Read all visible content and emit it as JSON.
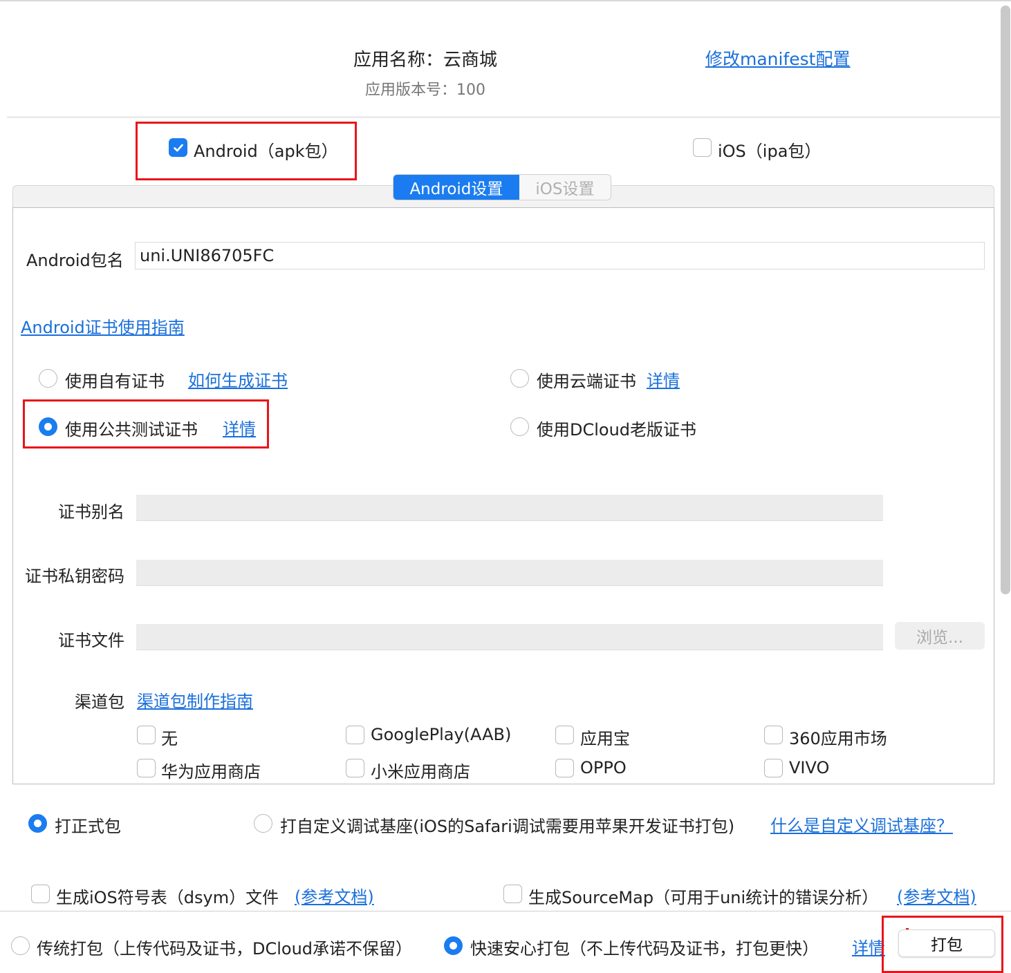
{
  "header": {
    "app_name": "应用名称：云商城",
    "app_version": "应用版本号：100",
    "manifest_link": "修改manifest配置"
  },
  "platforms": {
    "android": {
      "label": "Android（apk包）",
      "checked": true
    },
    "ios": {
      "label": "iOS（ipa包）",
      "checked": false
    }
  },
  "tabs": [
    {
      "label": "Android设置",
      "active": true
    },
    {
      "label": "iOS设置",
      "active": false
    }
  ],
  "android": {
    "package_label": "Android包名",
    "package_value": "uni.UNI86705FC",
    "cert_guide_link": "Android证书使用指南",
    "cert_options": {
      "own": {
        "label": "使用自有证书",
        "link": "如何生成证书",
        "checked": false
      },
      "cloud": {
        "label": "使用云端证书",
        "link": "详情",
        "checked": false
      },
      "public": {
        "label": "使用公共测试证书",
        "link": "详情",
        "checked": true
      },
      "dcloud_old": {
        "label": "使用DCloud老版证书",
        "checked": false
      }
    },
    "cert_alias_label": "证书别名",
    "cert_alias_value": "",
    "cert_password_label": "证书私钥密码",
    "cert_password_value": "",
    "cert_file_label": "证书文件",
    "cert_file_value": "",
    "browse_button": "浏览...",
    "channel_label": "渠道包",
    "channel_guide_link": "渠道包制作指南",
    "channels": [
      {
        "label": "无",
        "checked": false
      },
      {
        "label": "GooglePlay(AAB)",
        "checked": false
      },
      {
        "label": "应用宝",
        "checked": false
      },
      {
        "label": "360应用市场",
        "checked": false
      },
      {
        "label": "华为应用商店",
        "checked": false
      },
      {
        "label": "小米应用商店",
        "checked": false
      },
      {
        "label": "OPPO",
        "checked": false
      },
      {
        "label": "VIVO",
        "checked": false
      }
    ]
  },
  "build_type": {
    "release": {
      "label": "打正式包",
      "checked": true
    },
    "custom_debug": {
      "label": "打自定义调试基座(iOS的Safari调试需要用苹果开发证书打包)",
      "checked": false
    },
    "custom_debug_link": "什么是自定义调试基座？"
  },
  "extras": {
    "dsym": {
      "label": "生成iOS符号表（dsym）文件",
      "link": "(参考文档)",
      "checked": false
    },
    "sourcemap": {
      "label": "生成SourceMap（可用于uni统计的错误分析）",
      "link": "(参考文档)",
      "checked": false
    }
  },
  "upload_mode": {
    "traditional": {
      "label": "传统打包（上传代码及证书，DCloud承诺不保留）",
      "checked": false
    },
    "fast_safe": {
      "label": "快速安心打包（不上传代码及证书，打包更快）",
      "checked": true
    },
    "details_link": "详情"
  },
  "pack_button": "打包",
  "colors": {
    "accent": "#1a7cf0",
    "link": "#1a6fdb",
    "highlight": "#e8141c"
  }
}
